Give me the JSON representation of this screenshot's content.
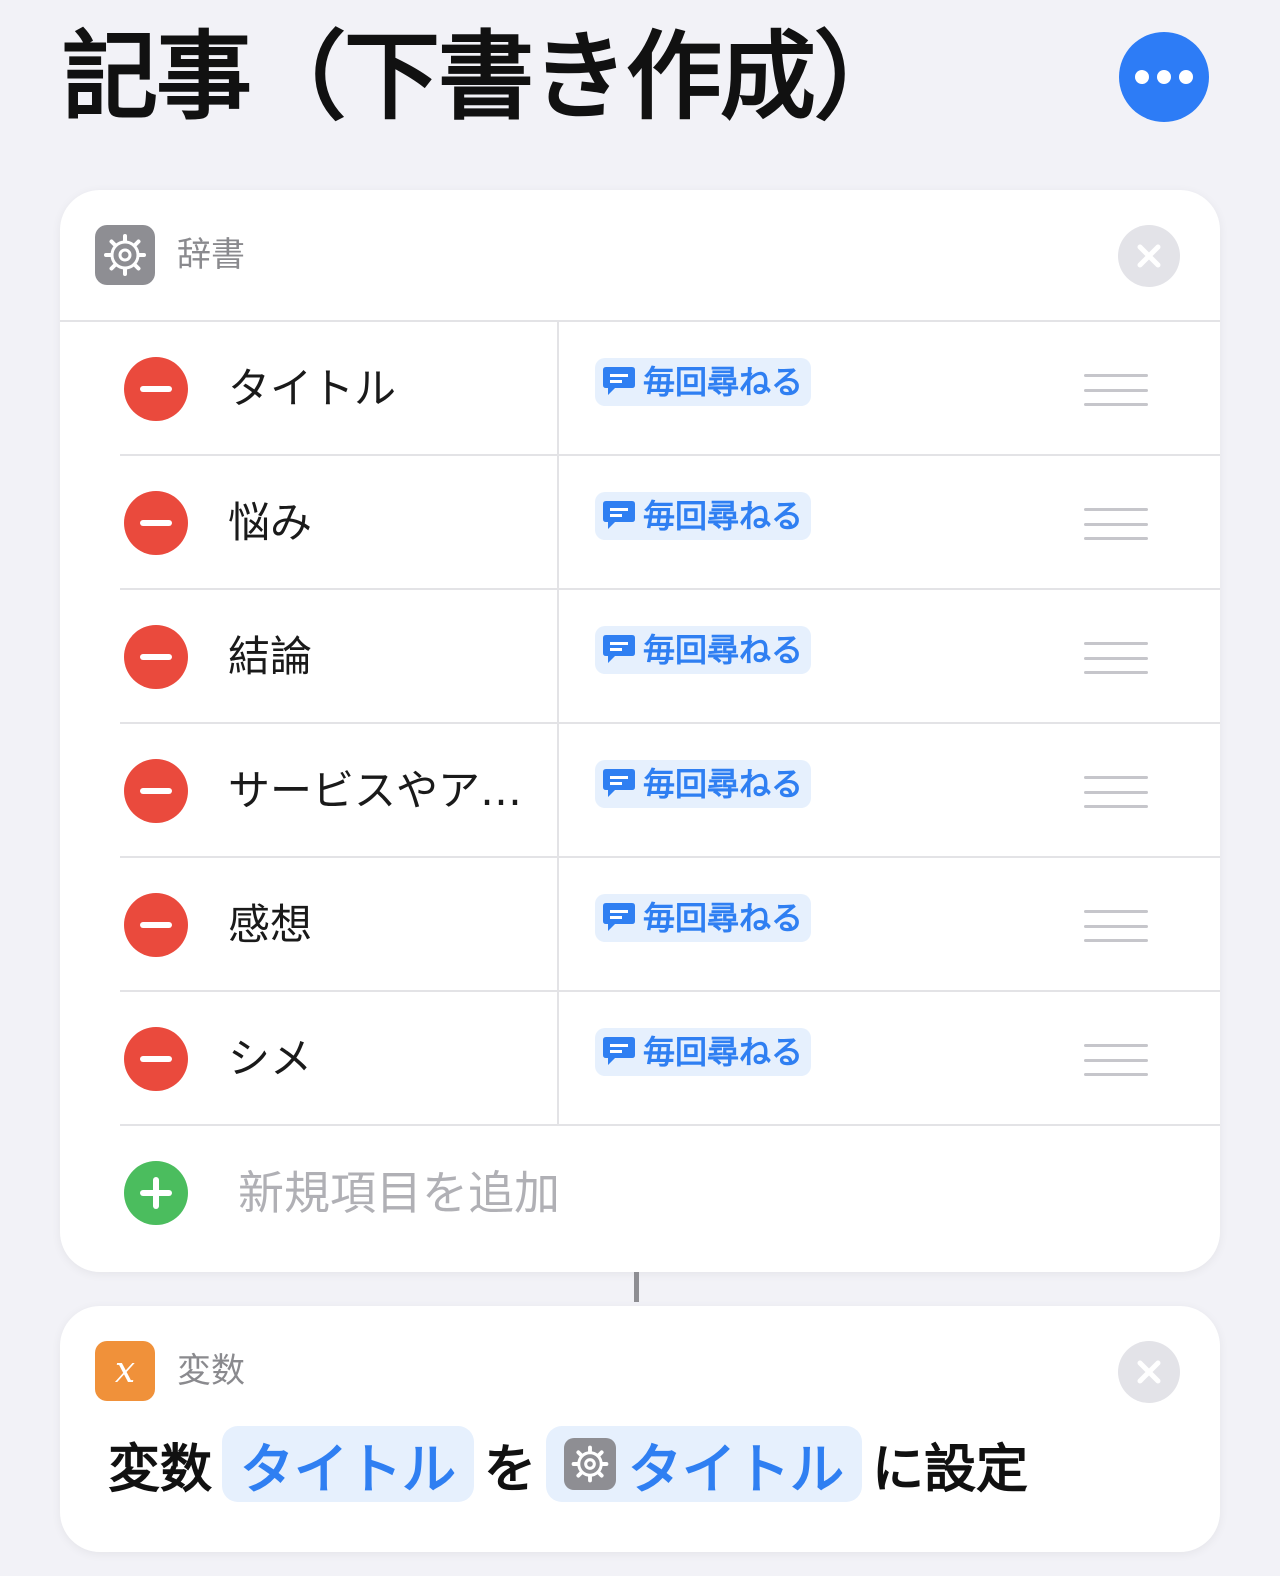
{
  "header": {
    "title": "記事（下書き作成）",
    "more_icon": "ellipsis-icon"
  },
  "dictionary_action": {
    "title": "辞書",
    "icon": "gear-icon",
    "rows": [
      {
        "key": "タイトル",
        "value": "毎回尋ねる"
      },
      {
        "key": "悩み",
        "value": "毎回尋ねる"
      },
      {
        "key": "結論",
        "value": "毎回尋ねる"
      },
      {
        "key": "サービスやア…",
        "value": "毎回尋ねる"
      },
      {
        "key": "感想",
        "value": "毎回尋ねる"
      },
      {
        "key": "シメ",
        "value": "毎回尋ねる"
      }
    ],
    "add_item_label": "新規項目を追加"
  },
  "variable_action": {
    "title": "変数",
    "icon": "x-variable-icon",
    "prefix": "変数",
    "variable_name": "タイトル",
    "connector": "を",
    "value_token": "タイトル",
    "suffix": "に設定"
  },
  "colors": {
    "accent": "#2d7cf6",
    "remove": "#ea4a3d",
    "add": "#4bbd5e",
    "variable_icon": "#f0913a",
    "gear_icon": "#8e8e93"
  }
}
